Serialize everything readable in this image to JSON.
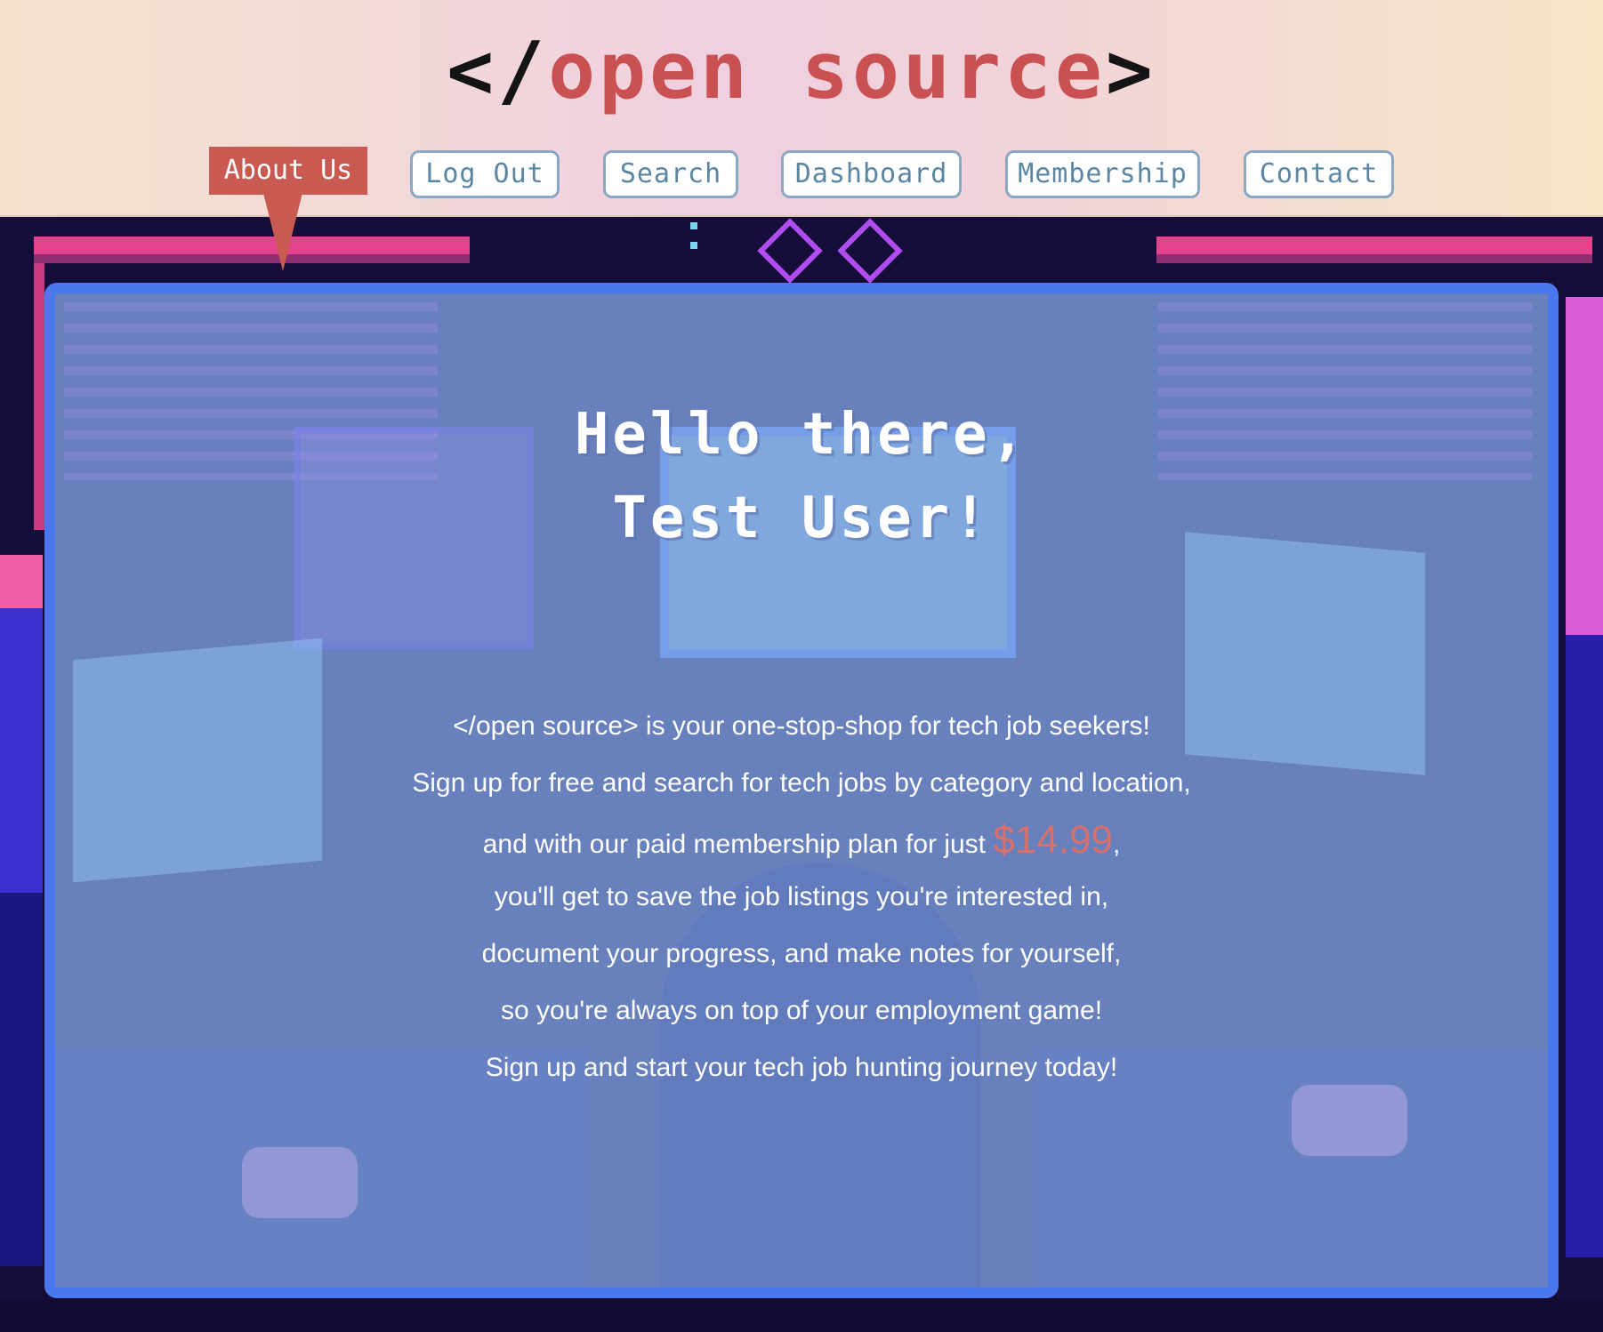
{
  "logo": {
    "open_bracket": "</",
    "word": "open source",
    "close_bracket": ">"
  },
  "nav": {
    "items": [
      {
        "label": "About Us",
        "active": true
      },
      {
        "label": "Log Out",
        "active": false
      },
      {
        "label": "Search",
        "active": false
      },
      {
        "label": "Dashboard",
        "active": false
      },
      {
        "label": "Membership",
        "active": false
      },
      {
        "label": "Contact",
        "active": false
      }
    ]
  },
  "hero": {
    "greeting_line1": "Hello there,",
    "greeting_line2": "Test User!"
  },
  "intro": {
    "line1": "</open source> is your one-stop-shop for tech job seekers!",
    "line2": "Sign up for free and search for tech jobs by category and location,",
    "line3_before": "and with our paid membership plan for just ",
    "price": "$14.99",
    "line3_after": ",",
    "line4": "you'll get to save the job listings you're interested in,",
    "line5": "document your progress, and make notes for yourself,",
    "line6": "so you're always on top of your employment game!",
    "line7": "Sign up and start your tech job hunting journey today!"
  },
  "colors": {
    "accent": "#c95a52",
    "card_border": "#4a79ee",
    "nav_text": "#5b86a3",
    "price": "#d8706b"
  }
}
